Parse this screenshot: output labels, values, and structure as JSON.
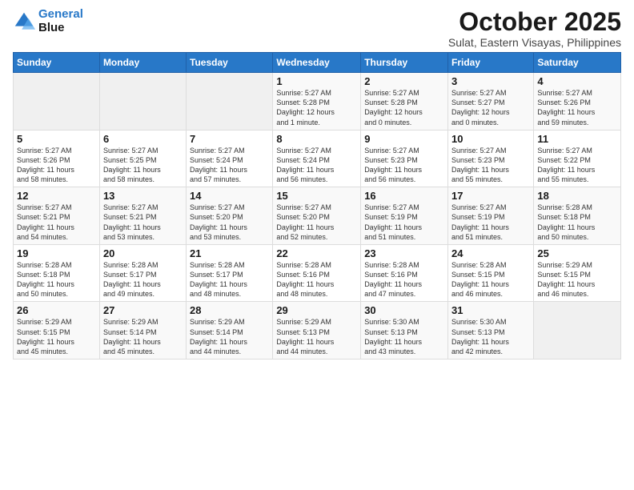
{
  "logo": {
    "line1": "General",
    "line2": "Blue"
  },
  "header": {
    "month": "October 2025",
    "location": "Sulat, Eastern Visayas, Philippines"
  },
  "weekdays": [
    "Sunday",
    "Monday",
    "Tuesday",
    "Wednesday",
    "Thursday",
    "Friday",
    "Saturday"
  ],
  "weeks": [
    [
      {
        "day": "",
        "info": ""
      },
      {
        "day": "",
        "info": ""
      },
      {
        "day": "",
        "info": ""
      },
      {
        "day": "1",
        "info": "Sunrise: 5:27 AM\nSunset: 5:28 PM\nDaylight: 12 hours\nand 1 minute."
      },
      {
        "day": "2",
        "info": "Sunrise: 5:27 AM\nSunset: 5:28 PM\nDaylight: 12 hours\nand 0 minutes."
      },
      {
        "day": "3",
        "info": "Sunrise: 5:27 AM\nSunset: 5:27 PM\nDaylight: 12 hours\nand 0 minutes."
      },
      {
        "day": "4",
        "info": "Sunrise: 5:27 AM\nSunset: 5:26 PM\nDaylight: 11 hours\nand 59 minutes."
      }
    ],
    [
      {
        "day": "5",
        "info": "Sunrise: 5:27 AM\nSunset: 5:26 PM\nDaylight: 11 hours\nand 58 minutes."
      },
      {
        "day": "6",
        "info": "Sunrise: 5:27 AM\nSunset: 5:25 PM\nDaylight: 11 hours\nand 58 minutes."
      },
      {
        "day": "7",
        "info": "Sunrise: 5:27 AM\nSunset: 5:24 PM\nDaylight: 11 hours\nand 57 minutes."
      },
      {
        "day": "8",
        "info": "Sunrise: 5:27 AM\nSunset: 5:24 PM\nDaylight: 11 hours\nand 56 minutes."
      },
      {
        "day": "9",
        "info": "Sunrise: 5:27 AM\nSunset: 5:23 PM\nDaylight: 11 hours\nand 56 minutes."
      },
      {
        "day": "10",
        "info": "Sunrise: 5:27 AM\nSunset: 5:23 PM\nDaylight: 11 hours\nand 55 minutes."
      },
      {
        "day": "11",
        "info": "Sunrise: 5:27 AM\nSunset: 5:22 PM\nDaylight: 11 hours\nand 55 minutes."
      }
    ],
    [
      {
        "day": "12",
        "info": "Sunrise: 5:27 AM\nSunset: 5:21 PM\nDaylight: 11 hours\nand 54 minutes."
      },
      {
        "day": "13",
        "info": "Sunrise: 5:27 AM\nSunset: 5:21 PM\nDaylight: 11 hours\nand 53 minutes."
      },
      {
        "day": "14",
        "info": "Sunrise: 5:27 AM\nSunset: 5:20 PM\nDaylight: 11 hours\nand 53 minutes."
      },
      {
        "day": "15",
        "info": "Sunrise: 5:27 AM\nSunset: 5:20 PM\nDaylight: 11 hours\nand 52 minutes."
      },
      {
        "day": "16",
        "info": "Sunrise: 5:27 AM\nSunset: 5:19 PM\nDaylight: 11 hours\nand 51 minutes."
      },
      {
        "day": "17",
        "info": "Sunrise: 5:27 AM\nSunset: 5:19 PM\nDaylight: 11 hours\nand 51 minutes."
      },
      {
        "day": "18",
        "info": "Sunrise: 5:28 AM\nSunset: 5:18 PM\nDaylight: 11 hours\nand 50 minutes."
      }
    ],
    [
      {
        "day": "19",
        "info": "Sunrise: 5:28 AM\nSunset: 5:18 PM\nDaylight: 11 hours\nand 50 minutes."
      },
      {
        "day": "20",
        "info": "Sunrise: 5:28 AM\nSunset: 5:17 PM\nDaylight: 11 hours\nand 49 minutes."
      },
      {
        "day": "21",
        "info": "Sunrise: 5:28 AM\nSunset: 5:17 PM\nDaylight: 11 hours\nand 48 minutes."
      },
      {
        "day": "22",
        "info": "Sunrise: 5:28 AM\nSunset: 5:16 PM\nDaylight: 11 hours\nand 48 minutes."
      },
      {
        "day": "23",
        "info": "Sunrise: 5:28 AM\nSunset: 5:16 PM\nDaylight: 11 hours\nand 47 minutes."
      },
      {
        "day": "24",
        "info": "Sunrise: 5:28 AM\nSunset: 5:15 PM\nDaylight: 11 hours\nand 46 minutes."
      },
      {
        "day": "25",
        "info": "Sunrise: 5:29 AM\nSunset: 5:15 PM\nDaylight: 11 hours\nand 46 minutes."
      }
    ],
    [
      {
        "day": "26",
        "info": "Sunrise: 5:29 AM\nSunset: 5:15 PM\nDaylight: 11 hours\nand 45 minutes."
      },
      {
        "day": "27",
        "info": "Sunrise: 5:29 AM\nSunset: 5:14 PM\nDaylight: 11 hours\nand 45 minutes."
      },
      {
        "day": "28",
        "info": "Sunrise: 5:29 AM\nSunset: 5:14 PM\nDaylight: 11 hours\nand 44 minutes."
      },
      {
        "day": "29",
        "info": "Sunrise: 5:29 AM\nSunset: 5:13 PM\nDaylight: 11 hours\nand 44 minutes."
      },
      {
        "day": "30",
        "info": "Sunrise: 5:30 AM\nSunset: 5:13 PM\nDaylight: 11 hours\nand 43 minutes."
      },
      {
        "day": "31",
        "info": "Sunrise: 5:30 AM\nSunset: 5:13 PM\nDaylight: 11 hours\nand 42 minutes."
      },
      {
        "day": "",
        "info": ""
      }
    ]
  ]
}
